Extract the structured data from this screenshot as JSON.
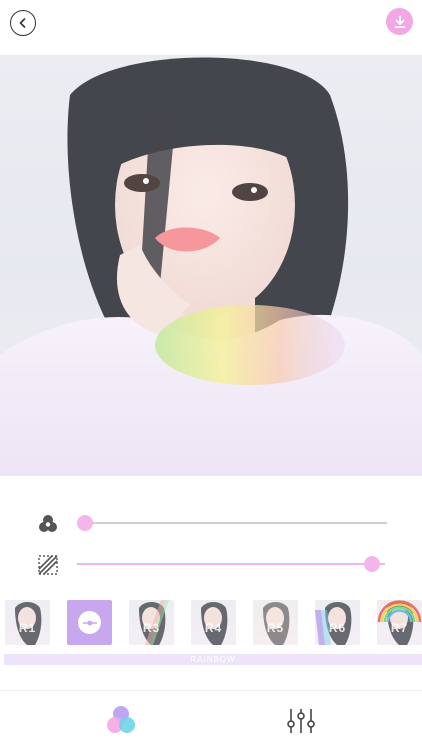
{
  "header": {
    "back_icon": "chevron-left-icon",
    "download_icon": "download-arrow-icon",
    "accent": "#f3a8e6"
  },
  "photo": {
    "description_icon": "portrait-photo"
  },
  "sliders": [
    {
      "icon": "color-circles-icon",
      "value": 0.0
    },
    {
      "icon": "texture-hatch-icon",
      "value": 1.0
    }
  ],
  "filters": {
    "items": [
      {
        "label": "R1",
        "selected": false
      },
      {
        "label": "",
        "selected": true
      },
      {
        "label": "R3",
        "selected": false
      },
      {
        "label": "R4",
        "selected": false
      },
      {
        "label": "R5",
        "selected": false
      },
      {
        "label": "R6",
        "selected": false
      },
      {
        "label": "R7",
        "selected": false
      }
    ],
    "group_label": "RAINBOW",
    "selected_color": "#c7a8ee"
  },
  "tabbar": {
    "tabs": [
      {
        "icon": "filter-circles-icon",
        "active": true
      },
      {
        "icon": "adjust-sliders-icon",
        "active": false
      }
    ]
  }
}
